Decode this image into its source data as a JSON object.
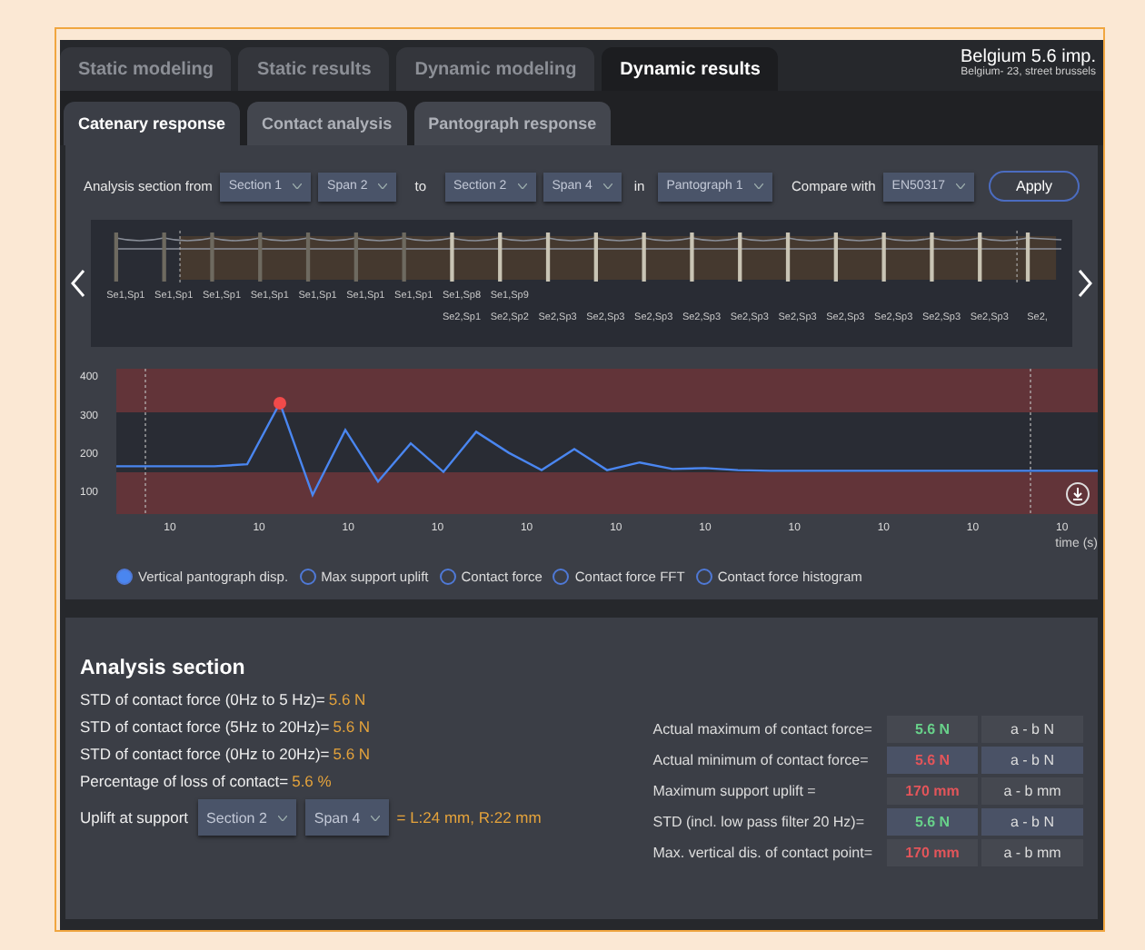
{
  "tabs": [
    {
      "label": "Static modeling",
      "selected": false
    },
    {
      "label": "Static results",
      "selected": false
    },
    {
      "label": "Dynamic modeling",
      "selected": false
    },
    {
      "label": "Dynamic results",
      "selected": true
    }
  ],
  "project": {
    "title": "Belgium 5.6 imp.",
    "address": "Belgium- 23, street brussels"
  },
  "subtabs": [
    {
      "label": "Catenary response",
      "selected": true
    },
    {
      "label": "Contact analysis",
      "selected": false
    },
    {
      "label": "Pantograph response",
      "selected": false
    }
  ],
  "filter": {
    "from_label": "Analysis section from",
    "from_section": "Section 1",
    "from_span": "Span 2",
    "to_label": "to",
    "to_section": "Section 2",
    "to_span": "Span 4",
    "in_label": "in",
    "pantograph": "Pantograph 1",
    "compare_label": "Compare with",
    "compare_value": "EN50317",
    "apply": "Apply"
  },
  "span_labels_top": [
    "Se1,Sp1",
    "Se1,Sp1",
    "Se1,Sp1",
    "Se1,Sp1",
    "Se1,Sp1",
    "Se1,Sp1",
    "Se1,Sp1",
    "Se1,Sp8",
    "Se1,Sp9"
  ],
  "span_labels_bottom": [
    "Se2,Sp1",
    "Se2,Sp2",
    "Se2,Sp3",
    "Se2,Sp3",
    "Se2,Sp3",
    "Se2,Sp3",
    "Se2,Sp3",
    "Se2,Sp3",
    "Se2,Sp3",
    "Se2,Sp3",
    "Se2,Sp3",
    "Se2,Sp3",
    "Se2,"
  ],
  "x_tick_labels": [
    "10",
    "10",
    "10",
    "10",
    "10",
    "10",
    "10",
    "10",
    "10",
    "10",
    "10"
  ],
  "chart_data": {
    "type": "line",
    "xlabel": "time (s)",
    "ylim": [
      40,
      420
    ],
    "categories": [
      null,
      null,
      null,
      null,
      null,
      null,
      null,
      null,
      null,
      null,
      null,
      null,
      null,
      null,
      null,
      null,
      null,
      null,
      null,
      null,
      null,
      null,
      null,
      null,
      null,
      null,
      null,
      null,
      null,
      null,
      null
    ],
    "series": [
      {
        "color": "#4a86f0",
        "values": [
          165,
          165,
          165,
          165,
          170,
          330,
          90,
          260,
          125,
          225,
          150,
          255,
          200,
          155,
          210,
          155,
          175,
          158,
          160,
          155,
          153,
          153,
          153,
          153,
          153,
          153,
          153,
          153,
          153,
          153,
          153
        ]
      }
    ],
    "yticks": [
      100,
      200,
      300,
      400
    ]
  },
  "legend": [
    {
      "label": "Vertical pantograph disp.",
      "selected": true
    },
    {
      "label": "Max support uplift",
      "selected": false
    },
    {
      "label": "Contact force",
      "selected": false
    },
    {
      "label": "Contact force FFT",
      "selected": false
    },
    {
      "label": "Contact force histogram",
      "selected": false
    }
  ],
  "analysis": {
    "title": "Analysis section",
    "stats": [
      {
        "label": "STD of contact force (0Hz to 5 Hz)=",
        "value": "5.6 N"
      },
      {
        "label": "STD of contact force (5Hz to 20Hz)=",
        "value": "5.6 N"
      },
      {
        "label": "STD of contact force (0Hz to 20Hz)=",
        "value": "5.6 N"
      },
      {
        "label": "Percentage of loss of contact=",
        "value": "5.6 %"
      }
    ],
    "uplift": {
      "label": "Uplift at support",
      "section": "Section 2",
      "span": "Span 4",
      "value": "= L:24 mm,  R:22 mm"
    },
    "results": [
      {
        "label": "Actual maximum of contact force=",
        "value": "5.6 N",
        "color": "#68d18a",
        "range": "a - b N"
      },
      {
        "label": "Actual minimum of contact force=",
        "value": "5.6 N",
        "color": "#e2555a",
        "range": "a - b N"
      },
      {
        "label": "Maximum support uplift =",
        "value": "170 mm",
        "color": "#e2555a",
        "range": "a - b mm"
      },
      {
        "label": "STD (incl. low pass filter 20 Hz)=",
        "value": "5.6 N",
        "color": "#68d18a",
        "range": "a - b N"
      },
      {
        "label": "Max. vertical dis. of contact point=",
        "value": "170 mm",
        "color": "#e2555a",
        "range": "a - b mm"
      }
    ]
  }
}
